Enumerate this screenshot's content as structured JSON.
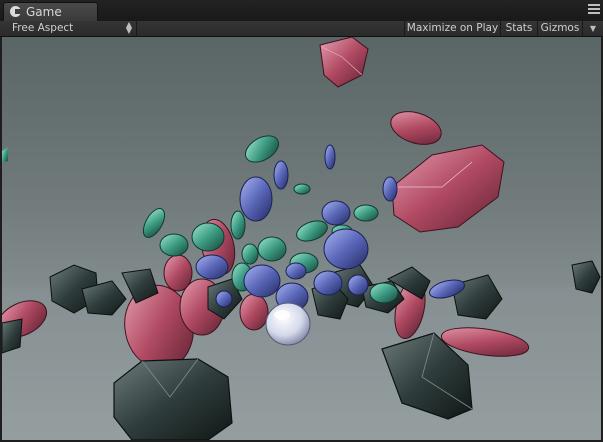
{
  "tab": {
    "title": "Game",
    "icon": "pacman-icon",
    "menu_icon": "tab-menu-icon"
  },
  "toolbar": {
    "aspect_value": "Free Aspect",
    "maximize_label": "Maximize on Play",
    "stats_label": "Stats",
    "gizmos_label": "Gizmos"
  },
  "scene": {
    "description_icon": "game-viewport",
    "colors": {
      "ruby": "#b04a62",
      "sapphire": "#5a67b8",
      "emerald": "#3e9c84",
      "onyx": "#2f3d3c",
      "pearl": "#e6e8f2"
    }
  }
}
